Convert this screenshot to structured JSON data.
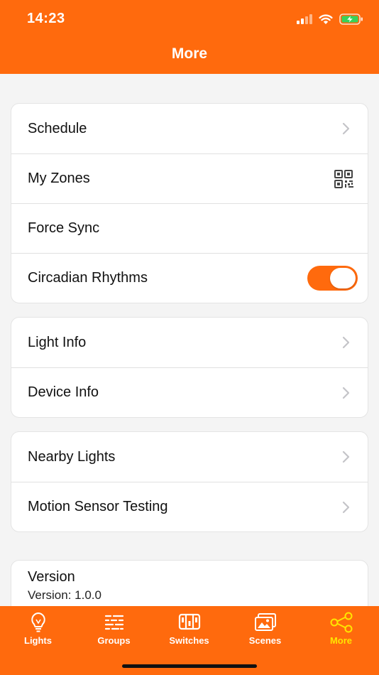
{
  "status_bar": {
    "time": "14:23"
  },
  "nav": {
    "title": "More"
  },
  "group1": [
    {
      "label": "Schedule",
      "accessory": "chevron-right-icon"
    },
    {
      "label": "My Zones",
      "accessory": "qr-code-icon"
    },
    {
      "label": "Force Sync",
      "accessory": "none"
    },
    {
      "label": "Circadian Rhythms",
      "accessory": "toggle",
      "toggle_on": true
    }
  ],
  "group2": [
    {
      "label": "Light Info",
      "accessory": "chevron-right-icon"
    },
    {
      "label": "Device Info",
      "accessory": "chevron-right-icon"
    }
  ],
  "group3": [
    {
      "label": "Nearby Lights",
      "accessory": "chevron-right-icon"
    },
    {
      "label": "Motion Sensor Testing",
      "accessory": "chevron-right-icon"
    }
  ],
  "version": {
    "title": "Version",
    "value": "Version: 1.0.0"
  },
  "tabs": [
    {
      "label": "Lights",
      "icon": "lightbulb-icon",
      "active": false
    },
    {
      "label": "Groups",
      "icon": "groups-icon",
      "active": false
    },
    {
      "label": "Switches",
      "icon": "switches-icon",
      "active": false
    },
    {
      "label": "Scenes",
      "icon": "scenes-icon",
      "active": false
    },
    {
      "label": "More",
      "icon": "share-nodes-icon",
      "active": true
    }
  ],
  "colors": {
    "accent": "#ff6a0d",
    "active_tab": "#ffe600",
    "background": "#f4f4f4",
    "chevron": "#c4c4c8"
  }
}
